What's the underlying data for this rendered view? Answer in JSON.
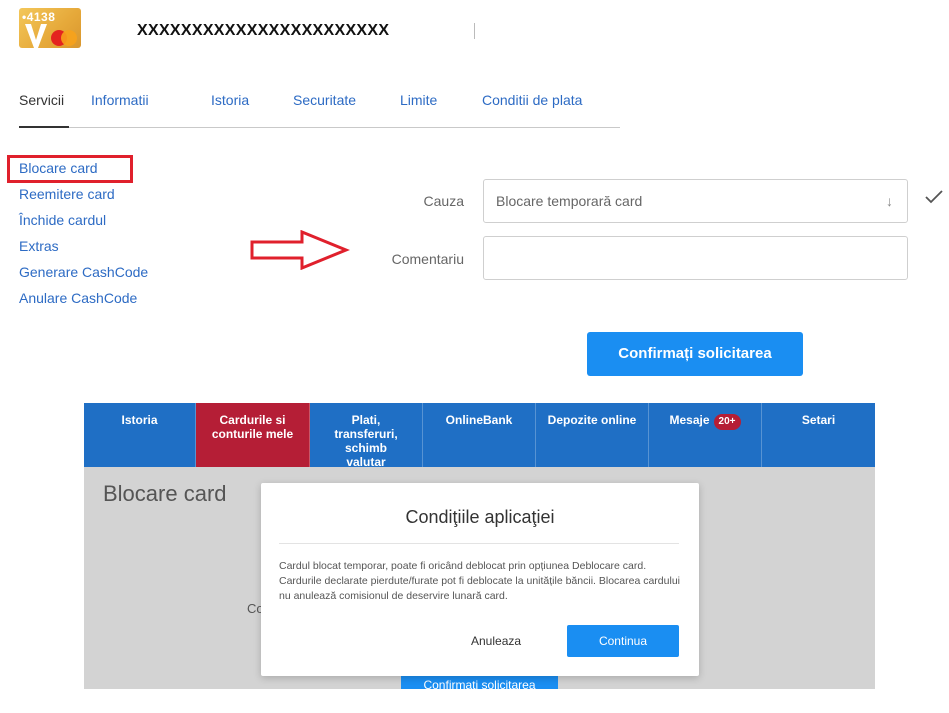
{
  "card": {
    "thumb_number": "•4138",
    "masked_number": "XXXXXXXXXXXXXXXXXXXXXXX"
  },
  "tabs": [
    {
      "label": "Servicii"
    },
    {
      "label": "Informatii"
    },
    {
      "label": "Istoria"
    },
    {
      "label": "Securitate"
    },
    {
      "label": "Limite"
    },
    {
      "label": "Conditii de plata"
    }
  ],
  "side_menu": [
    {
      "label": "Blocare card"
    },
    {
      "label": "Reemitere card"
    },
    {
      "label": "Închide cardul"
    },
    {
      "label": "Extras"
    },
    {
      "label": "Generare CashCode"
    },
    {
      "label": "Anulare CashCode"
    }
  ],
  "form": {
    "cause_label": "Cauza",
    "cause_value": "Blocare temporară card",
    "comment_label": "Comentariu",
    "comment_value": "",
    "confirm_label": "Confirmați solicitarea"
  },
  "colors": {
    "accent": "#1a8ef2",
    "nav_bg": "#1f6fc5",
    "nav_active": "#b51e36",
    "highlight": "#e0202c"
  },
  "screenshot": {
    "nav": [
      {
        "label": "Istoria"
      },
      {
        "label": "Cardurile si conturile mele"
      },
      {
        "label": "Plati, transferuri, schimb valutar"
      },
      {
        "label": "OnlineBank"
      },
      {
        "label": "Depozite online"
      },
      {
        "label": "Mesaje",
        "badge": "20+"
      },
      {
        "label": "Setari"
      }
    ],
    "page_title": "Blocare card",
    "bg_label_fragment": "Co",
    "bg_confirm_label": "Confirmați solicitarea",
    "modal": {
      "title": "Condiţiile aplicaţiei",
      "body": "Cardul blocat temporar, poate fi oricând deblocat prin opțiunea Deblocare card. Cardurile declarate pierdute/furate pot fi deblocate la unitățile băncii. Blocarea cardului nu anulează comisionul de deservire lunară card.",
      "cancel_label": "Anuleaza",
      "continue_label": "Continua"
    }
  }
}
